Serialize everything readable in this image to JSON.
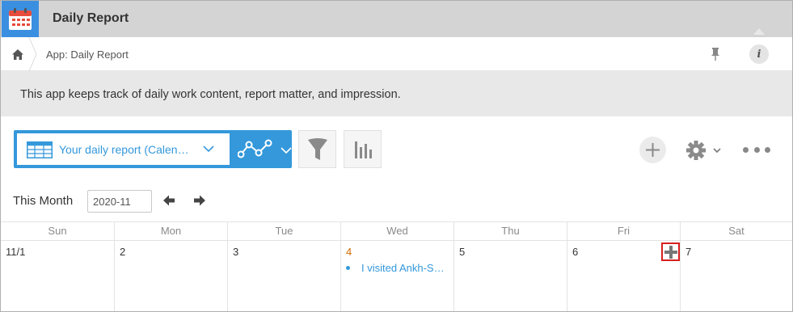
{
  "app": {
    "title": "Daily Report"
  },
  "breadcrumb": {
    "text": "App: Daily Report"
  },
  "description": "This app keeps track of daily work content, report matter, and impression.",
  "toolbar": {
    "view_name": "Your daily report (Calen…"
  },
  "month_nav": {
    "label": "This Month",
    "value": "2020-11"
  },
  "calendar": {
    "weekdays": [
      "Sun",
      "Mon",
      "Tue",
      "Wed",
      "Thu",
      "Fri",
      "Sat"
    ],
    "days": [
      "11/1",
      "2",
      "3",
      "4",
      "5",
      "6",
      "7"
    ],
    "today_index": 3,
    "entries": {
      "wed": "I visited Ankh-S…"
    }
  },
  "colors": {
    "accent": "#3498db",
    "titlebar": "#d4d4d4",
    "highlight": "#d61f1f"
  },
  "icons": {
    "app": "calendar-icon",
    "home": "home-icon",
    "pin": "pin-icon",
    "info": "info-icon",
    "view": "table-view-icon",
    "graph": "line-graph-icon",
    "filter": "filter-icon",
    "chart": "bar-chart-icon",
    "add": "plus-icon",
    "settings": "gear-icon",
    "more": "more-icon"
  }
}
